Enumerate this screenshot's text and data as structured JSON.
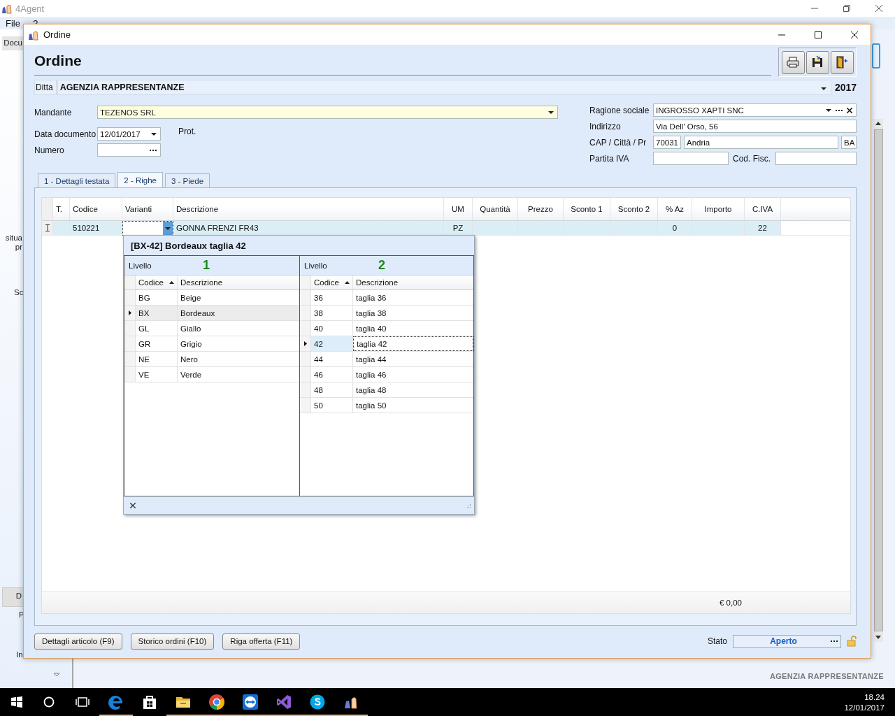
{
  "app": {
    "title": "4Agent",
    "menu": [
      "File",
      "?"
    ],
    "fragments": [
      "Docu",
      "situa",
      "pr",
      "Sc",
      "D",
      "P",
      "In"
    ],
    "status": "AGENZIA RAPPRESENTANZE"
  },
  "dialog": {
    "title": "Ordine",
    "heading": "Ordine",
    "ditta": {
      "label": "Ditta",
      "value": "AGENZIA RAPPRESENTANZE",
      "year": "2017"
    },
    "left_fields": [
      {
        "label": "Mandante",
        "value": "TEZENOS SRL",
        "kind": "combo"
      },
      {
        "label": "Data documento",
        "value": "12/01/2017",
        "kind": "date"
      },
      {
        "label": "Numero",
        "kind": "lookup"
      }
    ],
    "prot_label": "Prot.",
    "ragione_sociale": {
      "label": "Ragione sociale",
      "value": "INGROSSO XAPTI SNC"
    },
    "indirizzo": {
      "label": "Indirizzo",
      "value": "Via Dell' Orso, 56"
    },
    "cap_citta_pr": {
      "label": "CAP / Città / Pr",
      "cap": "70031",
      "citta": "Andria",
      "pr": "BA"
    },
    "partita_iva": {
      "label": "Partita IVA"
    },
    "cod_fisc": {
      "label": "Cod. Fisc."
    },
    "tabs": [
      {
        "label": "1 - Dettagli testata",
        "selected": false
      },
      {
        "label": "2 - Righe",
        "selected": true
      },
      {
        "label": "3 - Piede",
        "selected": false
      }
    ],
    "grid": {
      "columns": [
        "T.",
        "Codice",
        "Varianti",
        "Descrizione",
        "UM",
        "Quantità",
        "Prezzo",
        "Sconto 1",
        "Sconto 2",
        "% Az",
        "Importo",
        "C.IVA"
      ],
      "rows": [
        {
          "cells": [
            null,
            "510221",
            null,
            "GONNA FRENZI FR43",
            "PZ",
            null,
            null,
            null,
            null,
            "0",
            null,
            "22"
          ]
        }
      ],
      "total": "€ 0,00"
    },
    "variant_popup": {
      "title": "[BX-42] Bordeaux taglia 42",
      "levels": [
        {
          "label": "Livello",
          "number": "1",
          "columns": [
            "Codice",
            "Descrizione"
          ],
          "rows": [
            {
              "code": "BG",
              "description": "Beige",
              "selected": false
            },
            {
              "code": "BX",
              "description": "Bordeaux",
              "selected": true
            },
            {
              "code": "GL",
              "description": "Giallo",
              "selected": false
            },
            {
              "code": "GR",
              "description": "Grigio",
              "selected": false
            },
            {
              "code": "NE",
              "description": "Nero",
              "selected": false
            },
            {
              "code": "VE",
              "description": "Verde",
              "selected": false
            }
          ]
        },
        {
          "label": "Livello",
          "number": "2",
          "columns": [
            "Codice",
            "Descrizione"
          ],
          "rows": [
            {
              "code": "36",
              "description": "taglia 36",
              "selected": false
            },
            {
              "code": "38",
              "description": "taglia 38",
              "selected": false
            },
            {
              "code": "40",
              "description": "taglia 40",
              "selected": false
            },
            {
              "code": "42",
              "description": "taglia 42",
              "selected": true
            },
            {
              "code": "44",
              "description": "taglia 44",
              "selected": false
            },
            {
              "code": "46",
              "description": "taglia 46",
              "selected": false
            },
            {
              "code": "48",
              "description": "taglia 48",
              "selected": false
            },
            {
              "code": "50",
              "description": "taglia 50",
              "selected": false
            }
          ]
        }
      ]
    },
    "buttons": [
      "Dettagli articolo (F9)",
      "Storico ordini (F10)",
      "Riga offerta (F11)"
    ],
    "stato": {
      "label": "Stato",
      "value": "Aperto"
    }
  },
  "taskbar": {
    "apps": [
      {
        "kind": "edge",
        "running": true
      },
      {
        "kind": "store",
        "running": false
      },
      {
        "kind": "folder",
        "running": true
      },
      {
        "kind": "chrome",
        "running": true
      },
      {
        "kind": "teamviewer",
        "running": true
      },
      {
        "kind": "studio",
        "running": true
      },
      {
        "kind": "skype",
        "running": true
      },
      {
        "kind": "agent",
        "running": true
      }
    ],
    "time": "18.24",
    "date": "12/01/2017"
  }
}
